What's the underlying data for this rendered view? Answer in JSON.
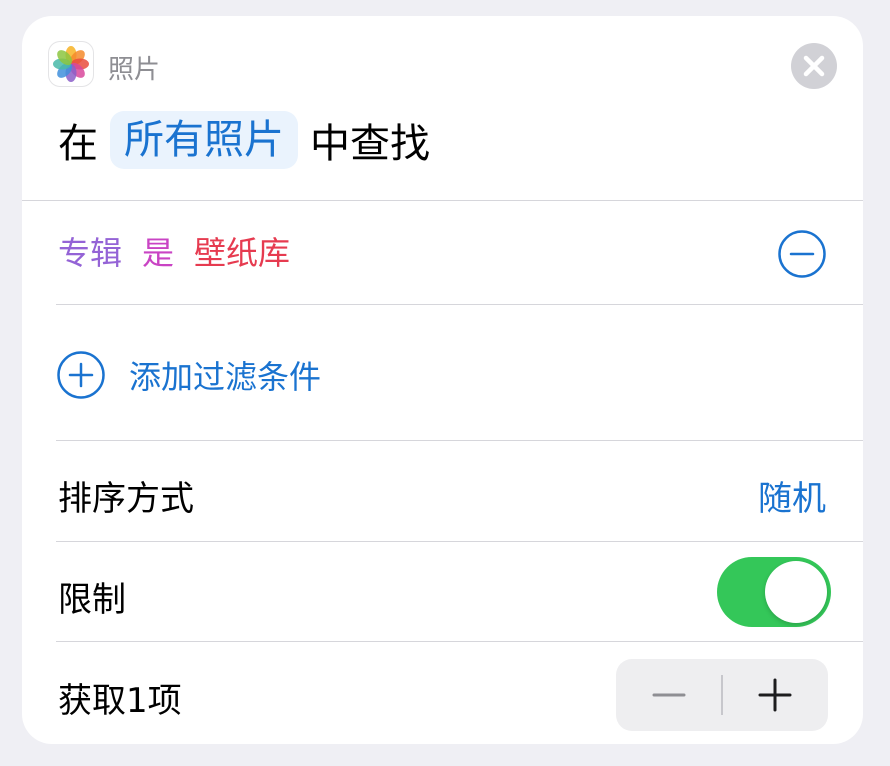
{
  "header": {
    "app_icon": "photos-app-icon",
    "app_name": "照片"
  },
  "headline": {
    "prefix": "在",
    "source_token": "所有照片",
    "suffix": "中查找"
  },
  "filter": {
    "property": "专辑",
    "operator": "是",
    "value": "壁纸库",
    "remove_icon": "minus-circle-icon"
  },
  "add_filter": {
    "label": "添加过滤条件",
    "icon": "plus-circle-icon"
  },
  "sort": {
    "label": "排序方式",
    "value": "随机"
  },
  "limit": {
    "label": "限制",
    "enabled": true
  },
  "count": {
    "label": "获取1项",
    "value": 1,
    "decrement_icon": "minus-icon",
    "increment_icon": "plus-icon"
  },
  "colors": {
    "accent": "#1a73d0",
    "toggle_on": "#34c759",
    "filter_property": "#9463d6",
    "filter_operator": "#c944c4",
    "filter_value": "#e63b50"
  }
}
